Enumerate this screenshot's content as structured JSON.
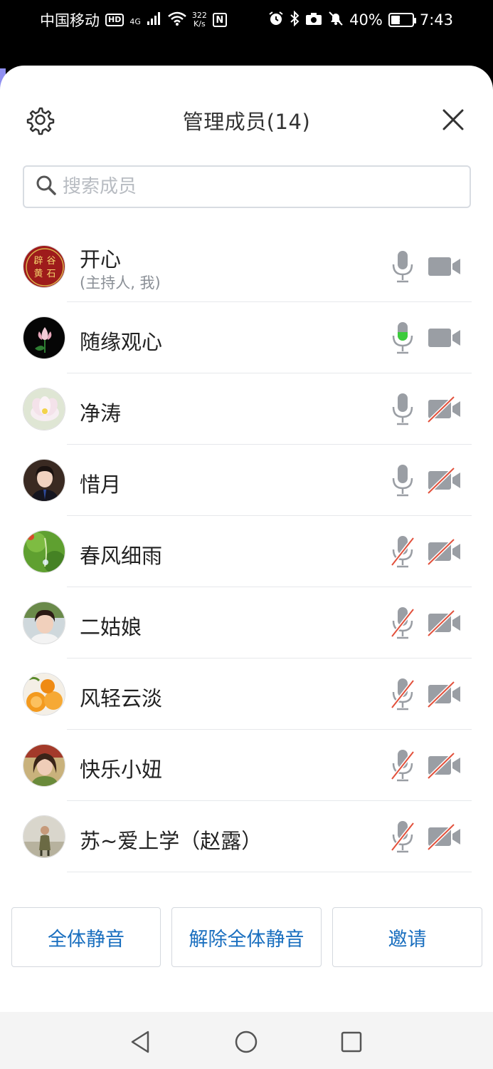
{
  "status_bar": {
    "carrier": "中国移动",
    "hd": "HD",
    "network": "4G",
    "speed_value": "322",
    "speed_unit": "K/s",
    "nfc": "N",
    "battery": "40%",
    "time": "7:43"
  },
  "header": {
    "title": "管理成员(14)",
    "settings_icon": "gear-icon",
    "close_icon": "close-icon"
  },
  "search": {
    "placeholder": "搜索成员",
    "value": ""
  },
  "members": [
    {
      "name": "开心",
      "subtitle": "(主持人, 我)",
      "mic": "on",
      "camera": "on",
      "avatar": "stone-seal",
      "avatar_text": [
        "辟",
        "谷",
        "黄",
        "石"
      ]
    },
    {
      "name": "随缘观心",
      "mic": "speaking",
      "camera": "on",
      "avatar": "lotus-dark"
    },
    {
      "name": "净涛",
      "mic": "on",
      "camera": "off",
      "avatar": "lotus-light"
    },
    {
      "name": "惜月",
      "mic": "on",
      "camera": "off",
      "avatar": "portrait-woman"
    },
    {
      "name": "春风细雨",
      "mic": "off",
      "camera": "off",
      "avatar": "green-leaf"
    },
    {
      "name": "二姑娘",
      "mic": "off",
      "camera": "off",
      "avatar": "portrait-woman-2"
    },
    {
      "name": "风轻云淡",
      "mic": "off",
      "camera": "off",
      "avatar": "oranges"
    },
    {
      "name": "快乐小妞",
      "mic": "off",
      "camera": "off",
      "avatar": "portrait-woman-3"
    },
    {
      "name": "苏~爱上学（赵露）",
      "mic": "off",
      "camera": "off",
      "avatar": "person-outdoor"
    }
  ],
  "actions": {
    "mute_all": "全体静音",
    "unmute_all": "解除全体静音",
    "invite": "邀请"
  },
  "colors": {
    "accent": "#1a6fbf",
    "icon_gray": "#9a9ea4",
    "muted_red": "#e2503b",
    "speaking_green": "#3ccb3c"
  }
}
